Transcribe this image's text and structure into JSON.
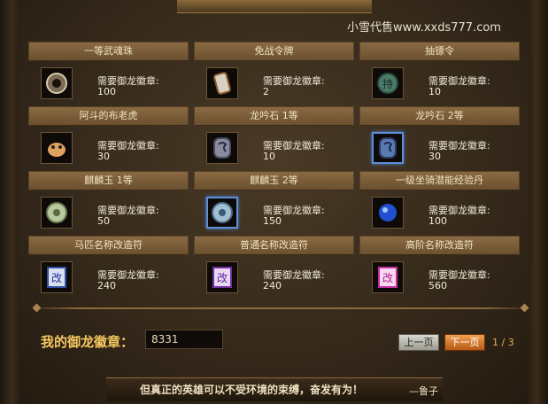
{
  "watermark": "小雪代售www.xxds777.com",
  "items": [
    {
      "name": "一等武魂珠",
      "cost_label": "需要御龙徽章:",
      "cost": "100",
      "icon": "orb-icon"
    },
    {
      "name": "免战令牌",
      "cost_label": "需要御龙徽章:",
      "cost": "2",
      "icon": "token-icon"
    },
    {
      "name": "抽镖令",
      "cost_label": "需要御龙徽章:",
      "cost": "10",
      "icon": "jade-token-icon"
    },
    {
      "name": "阿斗的布老虎",
      "cost_label": "需要御龙徽章:",
      "cost": "30",
      "icon": "cloth-tiger-icon"
    },
    {
      "name": "龙吟石 1等",
      "cost_label": "需要御龙徽章:",
      "cost": "10",
      "icon": "dragon-stone-icon"
    },
    {
      "name": "龙吟石 2等",
      "cost_label": "需要御龙徽章:",
      "cost": "30",
      "icon": "dragon-stone-blue-icon"
    },
    {
      "name": "麒麟玉 1等",
      "cost_label": "需要御龙徽章:",
      "cost": "50",
      "icon": "qilin-jade-icon"
    },
    {
      "name": "麒麟玉 2等",
      "cost_label": "需要御龙徽章:",
      "cost": "150",
      "icon": "qilin-jade-blue-icon"
    },
    {
      "name": "一级坐骑潜能经验丹",
      "cost_label": "需要御龙徽章:",
      "cost": "100",
      "icon": "blue-pill-icon"
    },
    {
      "name": "马匹名称改造符",
      "cost_label": "需要御龙徽章:",
      "cost": "240",
      "icon": "rename-charm-blue-icon"
    },
    {
      "name": "普通名称改造符",
      "cost_label": "需要御龙徽章:",
      "cost": "240",
      "icon": "rename-charm-purple-icon"
    },
    {
      "name": "高阶名称改造符",
      "cost_label": "需要御龙徽章:",
      "cost": "560",
      "icon": "rename-charm-pink-icon"
    }
  ],
  "footer": {
    "badge_label": "我的御龙徽章：",
    "badge_value": "8331",
    "prev_label": "上一页",
    "next_label": "下一页",
    "page": "1 / 3"
  },
  "quote": "但真正的英雄可以不受环境的束缚，奋发有为！",
  "quote_author": "—鲁子",
  "colors": {
    "accent": "#f6c860",
    "next_button": "#d0782a",
    "selected_border": "#5b8fd8"
  }
}
